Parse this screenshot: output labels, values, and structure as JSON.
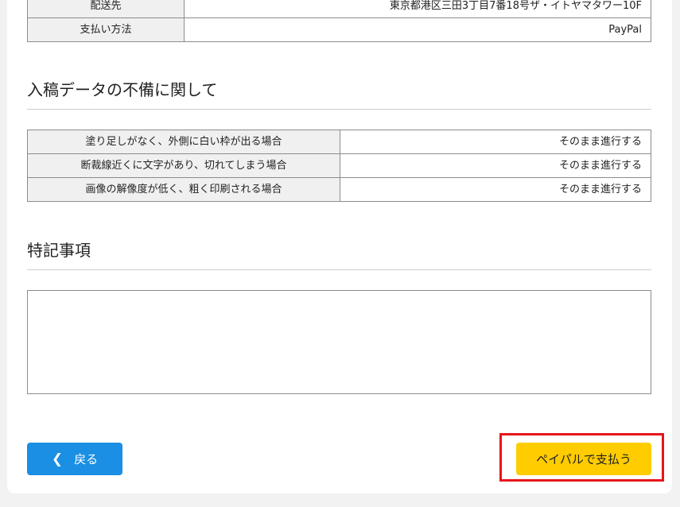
{
  "order_info": [
    {
      "label": "配送先",
      "value": "東京都港区三田3丁目7番18号ザ・イトヤマタワー10F"
    },
    {
      "label": "支払い方法",
      "value": "PayPal"
    }
  ],
  "data_issues": {
    "heading": "入稿データの不備に関して",
    "rows": [
      {
        "label": "塗り足しがなく、外側に白い枠が出る場合",
        "value": "そのまま進行する"
      },
      {
        "label": "断裁線近くに文字があり、切れてしまう場合",
        "value": "そのまま進行する"
      },
      {
        "label": "画像の解像度が低く、粗く印刷される場合",
        "value": "そのまま進行する"
      }
    ]
  },
  "notes": {
    "heading": "特記事項",
    "value": ""
  },
  "actions": {
    "back_icon": "chevron-left-icon",
    "back_label": "戻る",
    "pay_label": "ペイパルで支払う",
    "pay_color": "#ffcc00",
    "back_color": "#1a8fe3",
    "highlight_color": "#e8141c"
  }
}
